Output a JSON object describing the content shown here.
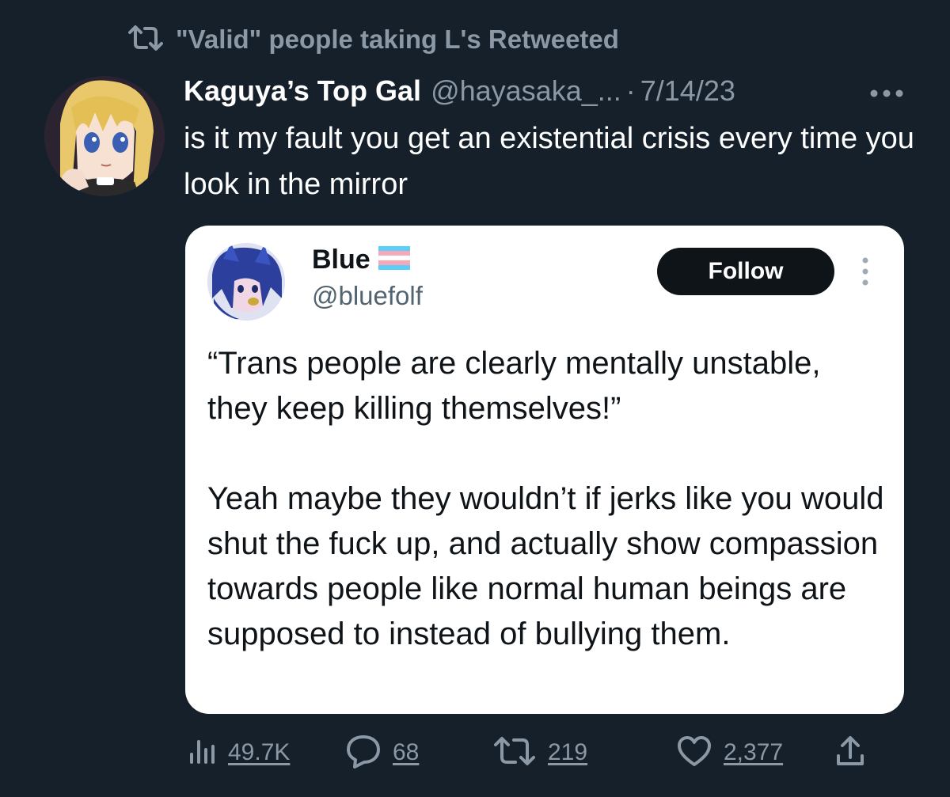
{
  "retweet_header": {
    "text": "\"Valid\" people taking L's Retweeted",
    "icon": "retweet-icon"
  },
  "tweet": {
    "display_name": "Kaguya’s Top Gal",
    "handle": "@hayasaka_...",
    "separator": "·",
    "date": "7/14/23",
    "text": "is it my fault you get an existential crisis every time you look in the mirror"
  },
  "quoted": {
    "display_name": "Blue",
    "flag": "trans-flag-icon",
    "handle": "@bluefolf",
    "follow_label": "Follow",
    "paragraph1": "“Trans people are clearly mentally unstable, they keep killing themselves!”",
    "paragraph2": "Yeah maybe they wouldn’t if jerks like you would shut the fuck up, and actually show compassion towards people like normal human beings are supposed to instead of bullying them."
  },
  "actions": {
    "views": "49.7K",
    "replies": "68",
    "retweets": "219",
    "likes": "2,377"
  },
  "colors": {
    "background": "#15202b",
    "muted": "#8b98a5",
    "card": "#ffffff",
    "follow_button": "#0f1419",
    "flag_blue": "#5bcefa",
    "flag_pink": "#f5a9b8"
  }
}
